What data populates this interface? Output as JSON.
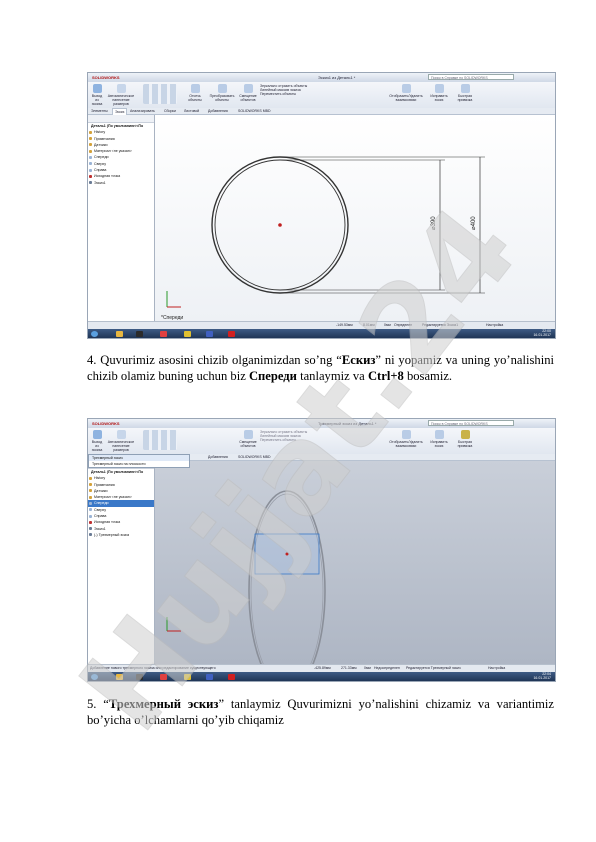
{
  "sw_ui": {
    "app_name": "SOLIDWORKS",
    "doc_title_1": "Эскиз1 из Деталь1 *",
    "doc_title_2": "Трехмерный эскиз из Деталь1 *",
    "search_placeholder": "Поиск в Справке по SOLIDWORKS",
    "ribbon": {
      "exit_sketch": "Выход из эскиза",
      "smart_dim": "Автоматическое нанесение размеров",
      "trim": "Отсечь объекты",
      "convert": "Преобразовать объекты",
      "offset": "Смещение объектов",
      "mirror": "Зеркально отразить объекты",
      "linear_pattern": "Линейный массив эскиза",
      "move": "Переместить объекты",
      "relations": "Отобразить/Удалить взаимосвязи",
      "repair": "Исправить эскиз",
      "quick_snaps": "Быстрая привязка"
    },
    "tabs": [
      "Элементы",
      "Эскиз",
      "Анализировать",
      "Сборки",
      "Листовой",
      "Добавления",
      "SOLIDWORKS MBD"
    ],
    "tree_items": [
      "Деталь1 (По умолчанию<<По",
      "History",
      "Примечания",
      "Датчики",
      "Материал <не указан>",
      "Спереди",
      "Сверху",
      "Справа",
      "Исходная точка",
      "Эскиз1"
    ],
    "tree_item_3d": "(-) Трехмерный эскиз",
    "popup_items": [
      "Трехмерный эскиз",
      "Трехмерный эскиз на плоскости"
    ],
    "status_1": [
      "-149.53мм",
      "8.01мм",
      "0мм",
      "Определен",
      "Редактируется Эскиз1",
      "Настройка"
    ],
    "status_2": [
      "Выберите одну или две кромки/вершины и затем текст",
      "-425.89мм",
      "271.33мм",
      "0мм",
      "Недоопределен",
      "Редактируется Трехмерный эскиз",
      "Настройка"
    ],
    "status_hint_2": "Добавление нового трехмерного эскиза или редактирование существующего",
    "dim_small": "⌀390",
    "dim_large": "⌀400",
    "view_label": "*Спереди",
    "clock_1": [
      "22:00",
      "16.01.2017"
    ],
    "clock_2": [
      "22:04",
      "16.01.2017"
    ]
  },
  "para4": {
    "t1": "4. Quvurimiz asosini chizib olganimizdan so’ng “",
    "b1": "Ескиз",
    "t2": "” ni yopamiz va  uning yo’nalishini chizib olamiz buning uchun biz ",
    "b2": "Спереди",
    "t3": " tanlaymiz va ",
    "b3": "Ctrl+8",
    "t4": " bosamiz."
  },
  "para5": {
    "t1": "5. “",
    "b1": "Трехмерный эскиз",
    "t2": "” tanlaymiz  Quvurimizni yo’nalishini chizamiz va variantimiz bo’yicha o’lchamlarni qo’yib chiqamiz"
  },
  "watermark": "Hujjat.24",
  "colors": {
    "watermark": "#cccccc",
    "accent_watermark": "#b48ad8",
    "sketch_blue": "#1f5fd6"
  }
}
